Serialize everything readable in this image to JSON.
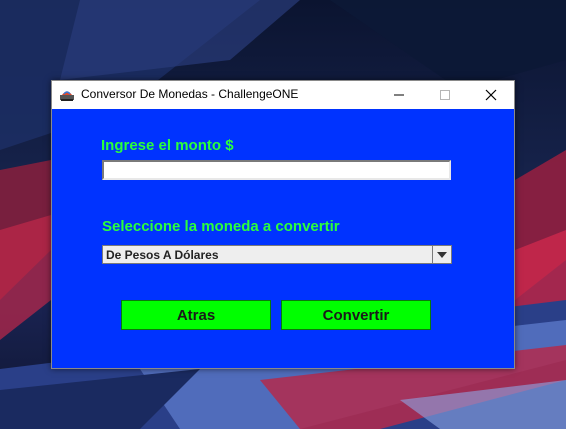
{
  "window": {
    "title": "Conversor De Monedas - ChallengeONE",
    "app_icon": "java-cup-icon",
    "controls": [
      "minimize-icon",
      "maximize-icon",
      "close-icon"
    ]
  },
  "form": {
    "amount_label": "Ingrese el monto $",
    "amount_value": "",
    "currency_label": "Seleccione la moneda a convertir",
    "currency_selected": "De Pesos A Dólares"
  },
  "buttons": {
    "back_label": "Atras",
    "convert_label": "Convertir"
  },
  "colors": {
    "panel_background": "#0033ff",
    "label_color": "#2bff3c",
    "button_background": "#00ff00"
  }
}
